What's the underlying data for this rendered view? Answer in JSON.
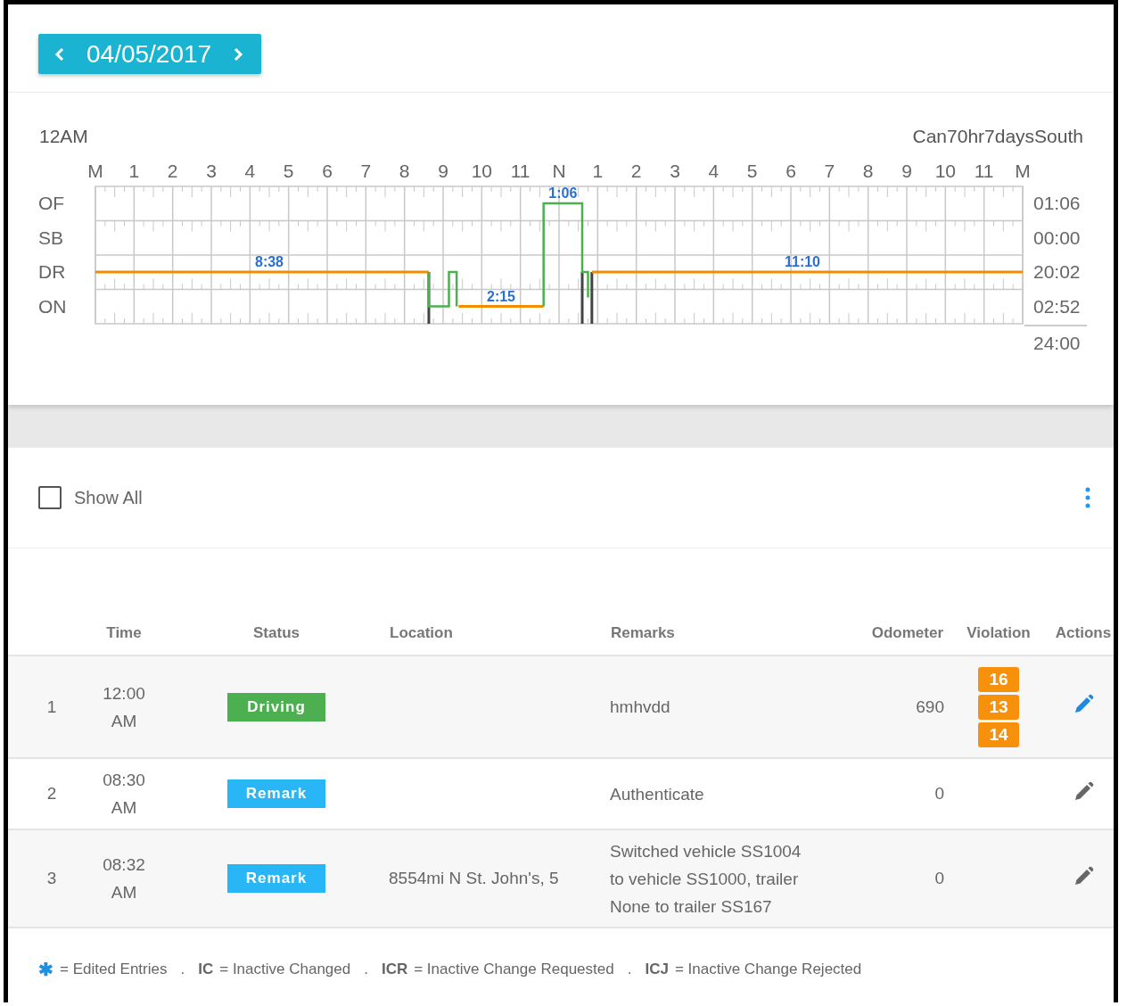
{
  "date_nav": {
    "date": "04/05/2017"
  },
  "log_chart": {
    "start_label": "12AM",
    "ruleset": "Can70hr7daysSouth",
    "hour_labels": [
      "M",
      "1",
      "2",
      "3",
      "4",
      "5",
      "6",
      "7",
      "8",
      "9",
      "10",
      "11",
      "N",
      "1",
      "2",
      "3",
      "4",
      "5",
      "6",
      "7",
      "8",
      "9",
      "10",
      "11",
      "M"
    ],
    "rows": [
      {
        "label": "OF",
        "total": "01:06"
      },
      {
        "label": "SB",
        "total": "00:00"
      },
      {
        "label": "DR",
        "total": "20:02"
      },
      {
        "label": "ON",
        "total": "02:52"
      }
    ],
    "day_total": "24:00",
    "durations": [
      "8:38",
      "2:15",
      "1:06",
      "11:10"
    ]
  },
  "show_all": {
    "label": "Show All",
    "checked": false
  },
  "table": {
    "columns": [
      "Time",
      "Status",
      "Location",
      "Remarks",
      "Odometer",
      "Violation",
      "Actions"
    ],
    "rows": [
      {
        "index": "1",
        "time": "12:00 AM",
        "status": {
          "label": "Driving",
          "color": "#4caf50"
        },
        "remarks": "hmhvdd",
        "odometer": "690",
        "violations": [
          "16",
          "13",
          "14"
        ],
        "edit_active": true
      },
      {
        "index": "2",
        "time": "08:30 AM",
        "status": {
          "label": "Remark",
          "color": "#29b6f6"
        },
        "remarks": "Authenticate",
        "odometer": "0",
        "edit_active": false
      },
      {
        "index": "3",
        "time": "08:32 AM",
        "status": {
          "label": "Remark",
          "color": "#29b6f6"
        },
        "location": "8554mi N St. John's, 5",
        "remarks": "Switched vehicle SS1004 to vehicle SS1000, trailer None to trailer SS167",
        "odometer": "0",
        "edit_active": false
      }
    ]
  },
  "legend": [
    {
      "kind": "symbol",
      "key": "✱",
      "text": "= Edited Entries"
    },
    {
      "kind": "separator",
      "text": "."
    },
    {
      "kind": "code",
      "key": "IC",
      "text": "= Inactive Changed"
    },
    {
      "kind": "separator",
      "text": "."
    },
    {
      "kind": "code",
      "key": "ICR",
      "text": "= Inactive Change Requested"
    },
    {
      "kind": "separator",
      "text": "."
    },
    {
      "kind": "code",
      "key": "ICJ",
      "text": "= Inactive Change Rejected"
    }
  ]
}
